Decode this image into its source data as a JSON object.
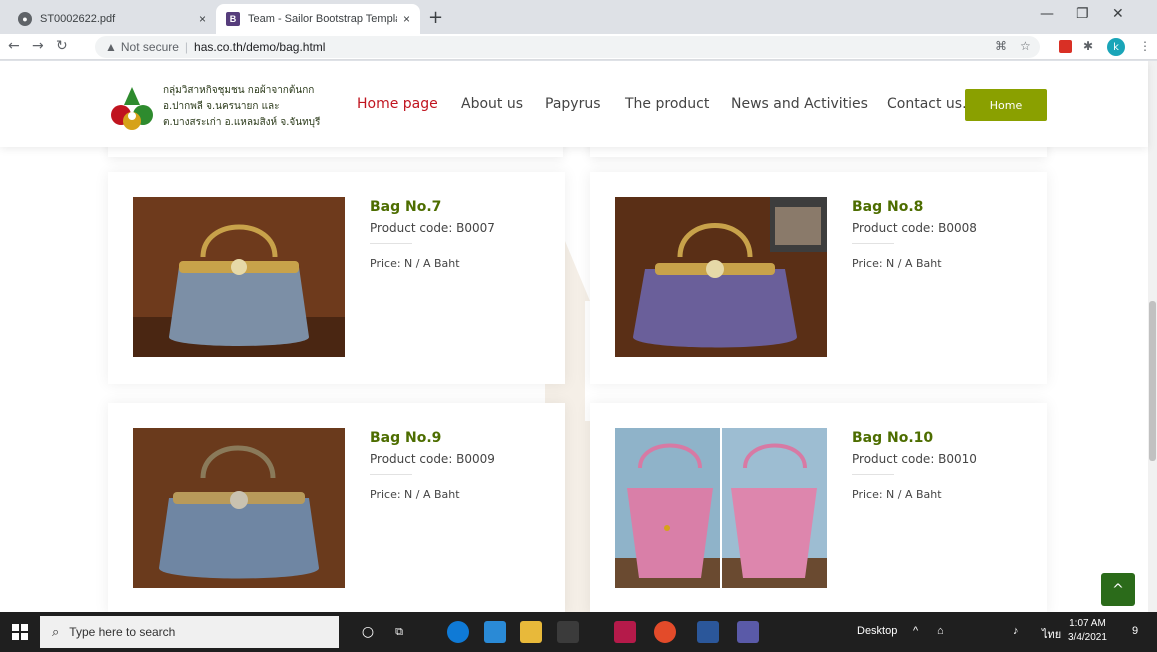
{
  "browser": {
    "tabs": [
      {
        "title": "ST0002622.pdf",
        "close": "×",
        "active": false,
        "icon": "globe-icon"
      },
      {
        "title": "Team - Sailor Bootstrap Template",
        "close": "×",
        "active": true,
        "icon": "bootstrap-icon",
        "fav_letter": "B"
      }
    ],
    "new_tab": "+",
    "address": {
      "security": "Not secure",
      "separator": "|",
      "url": "has.co.th/demo/bag.html"
    },
    "profile_initial": "k"
  },
  "site": {
    "brand_lines": [
      "กลุ่มวิสาหกิจชุมชน กอผ้าจากต้นกก",
      "อ.ปากพลี จ.นครนายก และ",
      "ต.บางสระเก่า อ.แหลมสิงห์ จ.จันทบุรี"
    ],
    "nav": [
      {
        "label": "Home page",
        "active": true
      },
      {
        "label": "About us",
        "active": false
      },
      {
        "label": "Papyrus",
        "active": false
      },
      {
        "label": "The product",
        "active": false
      },
      {
        "label": "News and Activities",
        "active": false
      },
      {
        "label": "Contact us.",
        "active": false
      }
    ],
    "home_button": "Home",
    "accent": "#8aa000",
    "active_nav_color": "#c0141f"
  },
  "products": [
    {
      "name": "Bag No.7",
      "code": "Product code: B0007",
      "price": "Price: N / A Baht"
    },
    {
      "name": "Bag No.8",
      "code": "Product code: B0008",
      "price": "Price: N / A Baht"
    },
    {
      "name": "Bag No.9",
      "code": "Product code: B0009",
      "price": "Price: N / A Baht"
    },
    {
      "name": "Bag No.10",
      "code": "Product code: B0010",
      "price": "Price: N / A Baht"
    }
  ],
  "back_to_top": "^",
  "taskbar": {
    "search_placeholder": "Type here to search",
    "desktop_label": "Desktop",
    "input_lang": "ไทย",
    "time": "1:07 AM",
    "date": "3/4/2021",
    "notifications": "9"
  }
}
